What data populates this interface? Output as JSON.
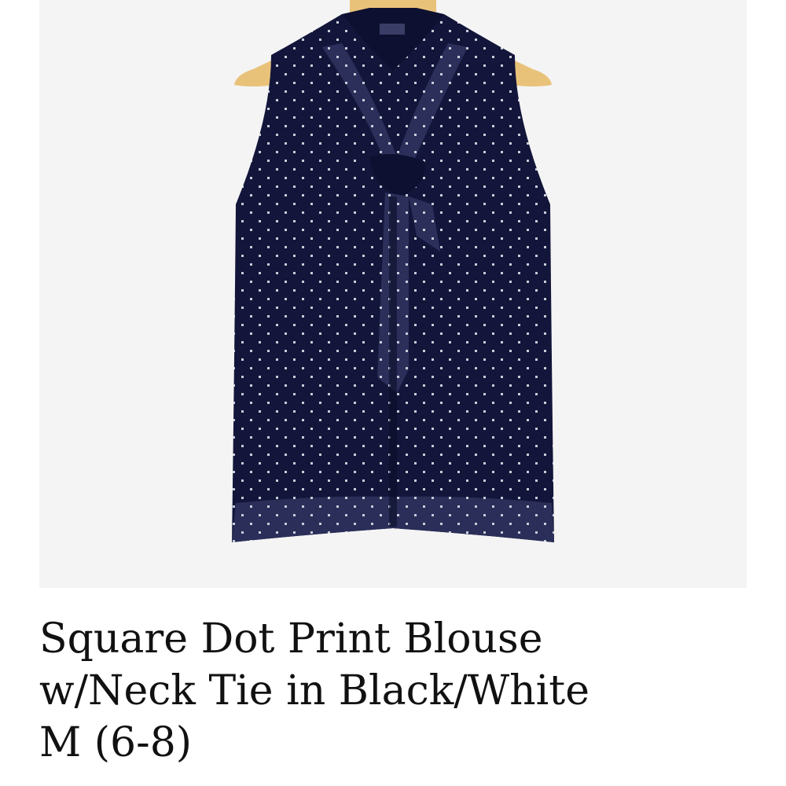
{
  "product": {
    "image_alt": "Sleeveless navy blouse with small white square dots and a neck tie, on a wooden hanger",
    "title_lines": [
      "Square Dot Print Blouse",
      "w/Neck Tie in Black/White",
      "M (6-8)"
    ]
  },
  "colors": {
    "background": "#ffffff",
    "photo_background": "#f4f4f4",
    "fabric": "#13163a",
    "dots": "#c9cdd8",
    "hanger": "#e9c27a",
    "text": "#111111"
  },
  "icons": {
    "product_photo": "blouse-on-hanger-photo"
  }
}
